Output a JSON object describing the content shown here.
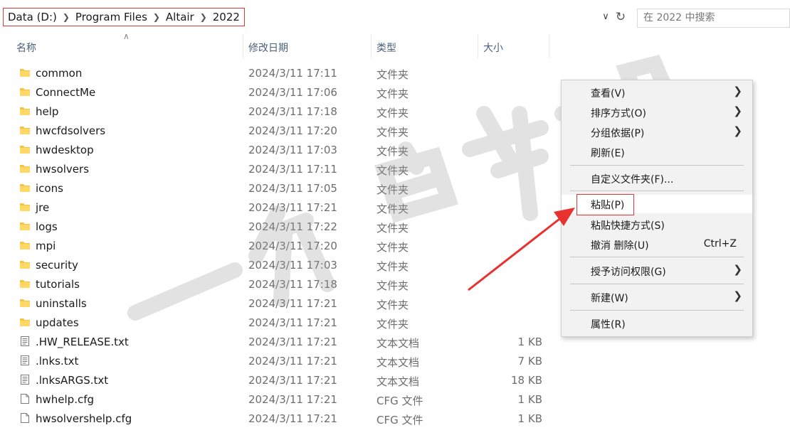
{
  "address_bar": {
    "breadcrumbs": [
      "Data (D:)",
      "Program Files",
      "Altair",
      "2022"
    ],
    "search_placeholder": "在 2022 中搜索"
  },
  "columns": {
    "name": "名称",
    "date": "修改日期",
    "type": "类型",
    "size": "大小"
  },
  "files": [
    {
      "name": "common",
      "date": "2024/3/11 17:11",
      "type": "文件夹",
      "size": "",
      "kind": "folder"
    },
    {
      "name": "ConnectMe",
      "date": "2024/3/11 17:06",
      "type": "文件夹",
      "size": "",
      "kind": "folder"
    },
    {
      "name": "help",
      "date": "2024/3/11 17:18",
      "type": "文件夹",
      "size": "",
      "kind": "folder"
    },
    {
      "name": "hwcfdsolvers",
      "date": "2024/3/11 17:20",
      "type": "文件夹",
      "size": "",
      "kind": "folder"
    },
    {
      "name": "hwdesktop",
      "date": "2024/3/11 17:03",
      "type": "文件夹",
      "size": "",
      "kind": "folder"
    },
    {
      "name": "hwsolvers",
      "date": "2024/3/11 17:11",
      "type": "文件夹",
      "size": "",
      "kind": "folder"
    },
    {
      "name": "icons",
      "date": "2024/3/11 17:05",
      "type": "文件夹",
      "size": "",
      "kind": "folder"
    },
    {
      "name": "jre",
      "date": "2024/3/11 17:21",
      "type": "文件夹",
      "size": "",
      "kind": "folder"
    },
    {
      "name": "logs",
      "date": "2024/3/11 17:22",
      "type": "文件夹",
      "size": "",
      "kind": "folder"
    },
    {
      "name": "mpi",
      "date": "2024/3/11 17:20",
      "type": "文件夹",
      "size": "",
      "kind": "folder"
    },
    {
      "name": "security",
      "date": "2024/3/11 17:03",
      "type": "文件夹",
      "size": "",
      "kind": "folder"
    },
    {
      "name": "tutorials",
      "date": "2024/3/11 17:18",
      "type": "文件夹",
      "size": "",
      "kind": "folder"
    },
    {
      "name": "uninstalls",
      "date": "2024/3/11 17:21",
      "type": "文件夹",
      "size": "",
      "kind": "folder"
    },
    {
      "name": "updates",
      "date": "2024/3/11 17:21",
      "type": "文件夹",
      "size": "",
      "kind": "folder"
    },
    {
      "name": ".HW_RELEASE.txt",
      "date": "2024/3/11 17:21",
      "type": "文本文档",
      "size": "1 KB",
      "kind": "text"
    },
    {
      "name": ".lnks.txt",
      "date": "2024/3/11 17:21",
      "type": "文本文档",
      "size": "7 KB",
      "kind": "text"
    },
    {
      "name": ".lnksARGS.txt",
      "date": "2024/3/11 17:21",
      "type": "文本文档",
      "size": "18 KB",
      "kind": "text"
    },
    {
      "name": "hwhelp.cfg",
      "date": "2024/3/11 17:21",
      "type": "CFG 文件",
      "size": "1 KB",
      "kind": "cfg"
    },
    {
      "name": "hwsolvershelp.cfg",
      "date": "2024/3/11 17:21",
      "type": "CFG 文件",
      "size": "1 KB",
      "kind": "cfg"
    }
  ],
  "context_menu": {
    "view": "查看(V)",
    "sort_by": "排序方式(O)",
    "group_by": "分组依据(P)",
    "refresh": "刷新(E)",
    "customize": "自定义文件夹(F)...",
    "paste": "粘贴(P)",
    "paste_shortcut": "粘贴快捷方式(S)",
    "undo_delete": "撤消 删除(U)",
    "undo_shortcut": "Ctrl+Z",
    "give_access": "授予访问权限(G)",
    "new": "新建(W)",
    "properties": "属性(R)"
  },
  "colors": {
    "highlight_box": "#e03a3a",
    "arrow": "#e8322f",
    "folder": "#f8c440"
  },
  "watermark_text": "一介白衣书生"
}
